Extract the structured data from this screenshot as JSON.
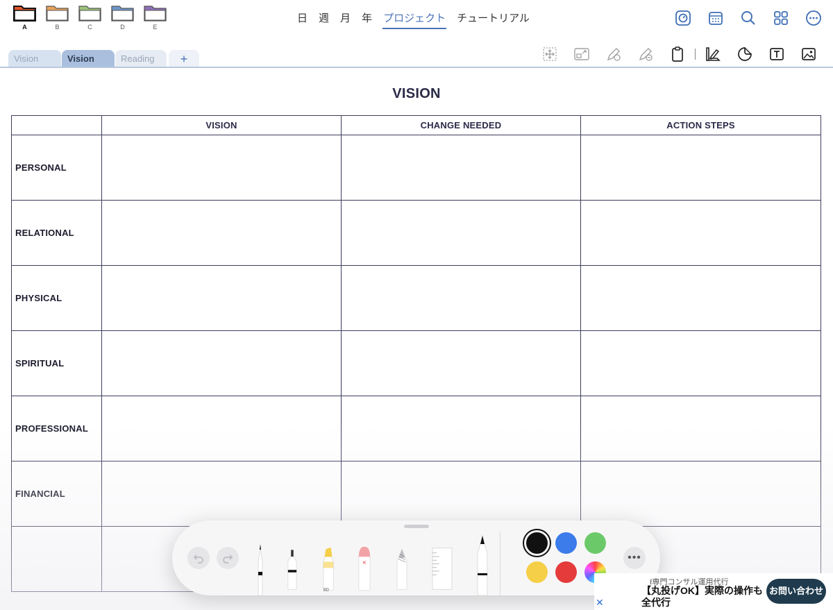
{
  "folders": [
    {
      "label": "A",
      "color": "#e2572b",
      "active": true
    },
    {
      "label": "B",
      "color": "#e8a35a",
      "active": false
    },
    {
      "label": "C",
      "color": "#9cc27a",
      "active": false
    },
    {
      "label": "D",
      "color": "#6f98c9",
      "active": false
    },
    {
      "label": "E",
      "color": "#8f6fb8",
      "active": false
    }
  ],
  "nav": {
    "tabs": [
      {
        "label": "日"
      },
      {
        "label": "週"
      },
      {
        "label": "月"
      },
      {
        "label": "年"
      },
      {
        "label": "プロジェクト",
        "active": true
      },
      {
        "label": "チュートリアル"
      }
    ]
  },
  "top_icons": [
    "timer-icon",
    "calendar-icon",
    "search-icon",
    "grid-icon",
    "more-icon"
  ],
  "doc_tabs": [
    {
      "label": "Vision"
    },
    {
      "label": "Vision",
      "active": true
    },
    {
      "label": "Reading L"
    },
    {
      "label": "+"
    }
  ],
  "tool_icons": [
    "select-move-icon",
    "resize-icon",
    "pen-settings-icon",
    "pen-erase-icon",
    "clipboard-icon",
    "ruler-pencil-icon",
    "sticker-icon",
    "text-box-icon",
    "image-icon"
  ],
  "page": {
    "title": "VISION",
    "columns": [
      "",
      "VISION",
      "CHANGE NEEDED",
      "ACTION STEPS"
    ],
    "rows": [
      "PERSONAL",
      "RELATIONAL",
      "PHYSICAL",
      "SPIRITUAL",
      "PROFESSIONAL",
      "FINANCIAL",
      ""
    ]
  },
  "palette": {
    "tools": [
      "pen-tool",
      "fineliner-tool",
      "highlighter-tool",
      "eraser-tool",
      "pencil-tool",
      "ruler-tool",
      "marker-tool"
    ],
    "highlighter_label": "80",
    "colors": [
      "#111111",
      "#3b7bea",
      "#6cc96a",
      "#f5cf47",
      "#e53b3b",
      "color-wheel"
    ],
    "selected_color": "#111111",
    "more_label": "•••"
  },
  "ad": {
    "subtitle": "ℓ専門コンサル運用代行",
    "headline": "【丸投げOK】実際の操作も全代行",
    "button": "お問い合わせ",
    "close": "✕"
  }
}
